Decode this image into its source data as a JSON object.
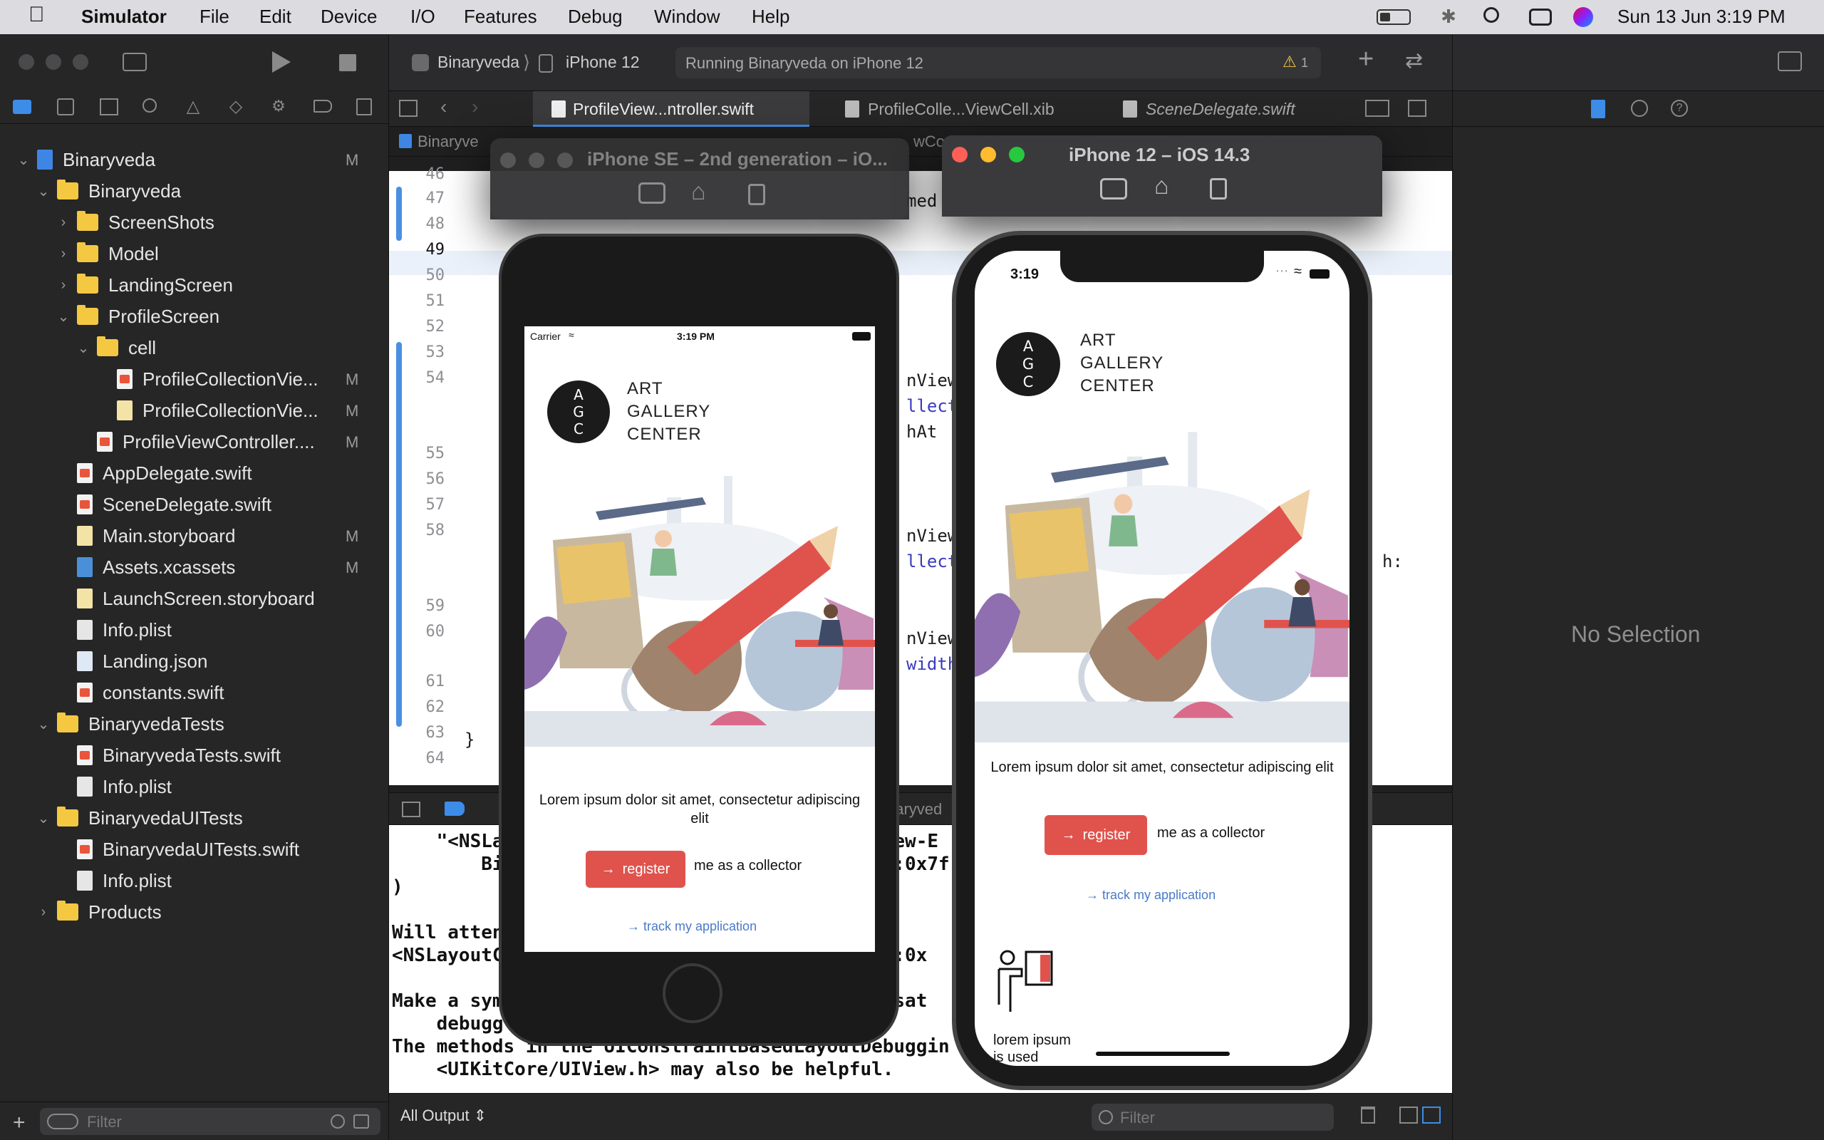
{
  "menubar": {
    "app": "Simulator",
    "items": [
      "File",
      "Edit",
      "Device",
      "I/O",
      "Features",
      "Debug",
      "Window",
      "Help"
    ],
    "datetime": "Sun 13 Jun  3:19 PM"
  },
  "toolbar": {
    "scheme": "Binaryveda",
    "device": "iPhone 12",
    "status": "Running Binaryveda on iPhone 12",
    "warning_count": "1"
  },
  "tabs": [
    {
      "label": "ProfileView...ntroller.swift",
      "active": true
    },
    {
      "label": "ProfileColle...ViewCell.xib",
      "active": false
    },
    {
      "label": "SceneDelegate.swift",
      "active": false
    }
  ],
  "jumpbar": {
    "root": "Binaryve",
    "tail": "wCon"
  },
  "navigator": {
    "rows": [
      {
        "label": "Binaryveda",
        "icon": "proj",
        "indent": 0,
        "disc": "open",
        "badge": "M"
      },
      {
        "label": "Binaryveda",
        "icon": "folder",
        "indent": 1,
        "disc": "open",
        "badge": ""
      },
      {
        "label": "ScreenShots",
        "icon": "folder",
        "indent": 2,
        "disc": "closed",
        "badge": ""
      },
      {
        "label": "Model",
        "icon": "folder",
        "indent": 2,
        "disc": "closed",
        "badge": ""
      },
      {
        "label": "LandingScreen",
        "icon": "folder",
        "indent": 2,
        "disc": "closed",
        "badge": ""
      },
      {
        "label": "ProfileScreen",
        "icon": "folder",
        "indent": 2,
        "disc": "open",
        "badge": ""
      },
      {
        "label": "cell",
        "icon": "folder",
        "indent": 3,
        "disc": "open",
        "badge": ""
      },
      {
        "label": "ProfileCollectionVie...",
        "icon": "swift",
        "indent": 4,
        "disc": "",
        "badge": "M"
      },
      {
        "label": "ProfileCollectionVie...",
        "icon": "xib",
        "indent": 4,
        "disc": "",
        "badge": "M"
      },
      {
        "label": "ProfileViewController....",
        "icon": "swift",
        "indent": 3,
        "disc": "",
        "badge": "M"
      },
      {
        "label": "AppDelegate.swift",
        "icon": "swift",
        "indent": 2,
        "disc": "",
        "badge": ""
      },
      {
        "label": "SceneDelegate.swift",
        "icon": "swift",
        "indent": 2,
        "disc": "",
        "badge": ""
      },
      {
        "label": "Main.storyboard",
        "icon": "xib",
        "indent": 2,
        "disc": "",
        "badge": "M"
      },
      {
        "label": "Assets.xcassets",
        "icon": "assets",
        "indent": 2,
        "disc": "",
        "badge": "M"
      },
      {
        "label": "LaunchScreen.storyboard",
        "icon": "xib",
        "indent": 2,
        "disc": "",
        "badge": ""
      },
      {
        "label": "Info.plist",
        "icon": "file",
        "indent": 2,
        "disc": "",
        "badge": ""
      },
      {
        "label": "Landing.json",
        "icon": "json",
        "indent": 2,
        "disc": "",
        "badge": ""
      },
      {
        "label": "constants.swift",
        "icon": "swift",
        "indent": 2,
        "disc": "",
        "badge": ""
      },
      {
        "label": "BinaryvedaTests",
        "icon": "folder",
        "indent": 1,
        "disc": "open",
        "badge": ""
      },
      {
        "label": "BinaryvedaTests.swift",
        "icon": "swift",
        "indent": 2,
        "disc": "",
        "badge": ""
      },
      {
        "label": "Info.plist",
        "icon": "file",
        "indent": 2,
        "disc": "",
        "badge": ""
      },
      {
        "label": "BinaryvedaUITests",
        "icon": "folder",
        "indent": 1,
        "disc": "open",
        "badge": ""
      },
      {
        "label": "BinaryvedaUITests.swift",
        "icon": "swift",
        "indent": 2,
        "disc": "",
        "badge": ""
      },
      {
        "label": "Info.plist",
        "icon": "file",
        "indent": 2,
        "disc": "",
        "badge": ""
      },
      {
        "label": "Products",
        "icon": "folder",
        "indent": 1,
        "disc": "closed",
        "badge": ""
      }
    ],
    "filter_placeholder": "Filter"
  },
  "code": {
    "line_numbers": [
      "46",
      "47",
      "48",
      "49",
      "50",
      "51",
      "52",
      "53",
      "54",
      "55",
      "56",
      "57",
      "58",
      "59",
      "60",
      "61",
      "62",
      "63",
      "64"
    ],
    "fragments": [
      "med",
      "nView",
      "llect",
      "hAt",
      "nView",
      "llecti",
      "h:",
      "nView",
      "width",
      "}"
    ]
  },
  "console": {
    "lines": [
      "    \"<NSLa                                  iew-E",
      "        Bi                                   :0x7f                               ve)>\"",
      ")",
      "",
      "Will atten                                 nt",
      "<NSLayoutC                                 ew:0x                              >",
      "",
      "Make a sym                                 Unsat                               the",
      "    debugg",
      "The methods in the UIConstraintBasedLayoutDebuggin",
      "    <UIKitCore/UIView.h> may also be helpful."
    ],
    "output_select": "All Output",
    "filter_placeholder": "Filter",
    "debug_bar_tail": "naryved"
  },
  "inspector": {
    "no_selection": "No Selection"
  },
  "sim_se": {
    "title": "iPhone SE – 2nd generation – iO...",
    "carrier": "Carrier",
    "time": "3:19 PM"
  },
  "sim_12": {
    "title": "iPhone 12 – iOS 14.3",
    "time": "3:19"
  },
  "app": {
    "logo_letters": [
      "A",
      "G",
      "C"
    ],
    "title_lines": [
      "ART",
      "GALLERY",
      "CENTER"
    ],
    "lorem": "Lorem ipsum dolor sit amet, consectetur adipiscing elit",
    "register": "register",
    "collector": "me as a collector",
    "track": "track my application",
    "lorem_used_1": "lorem ipsum",
    "lorem_used_2": "is used"
  }
}
